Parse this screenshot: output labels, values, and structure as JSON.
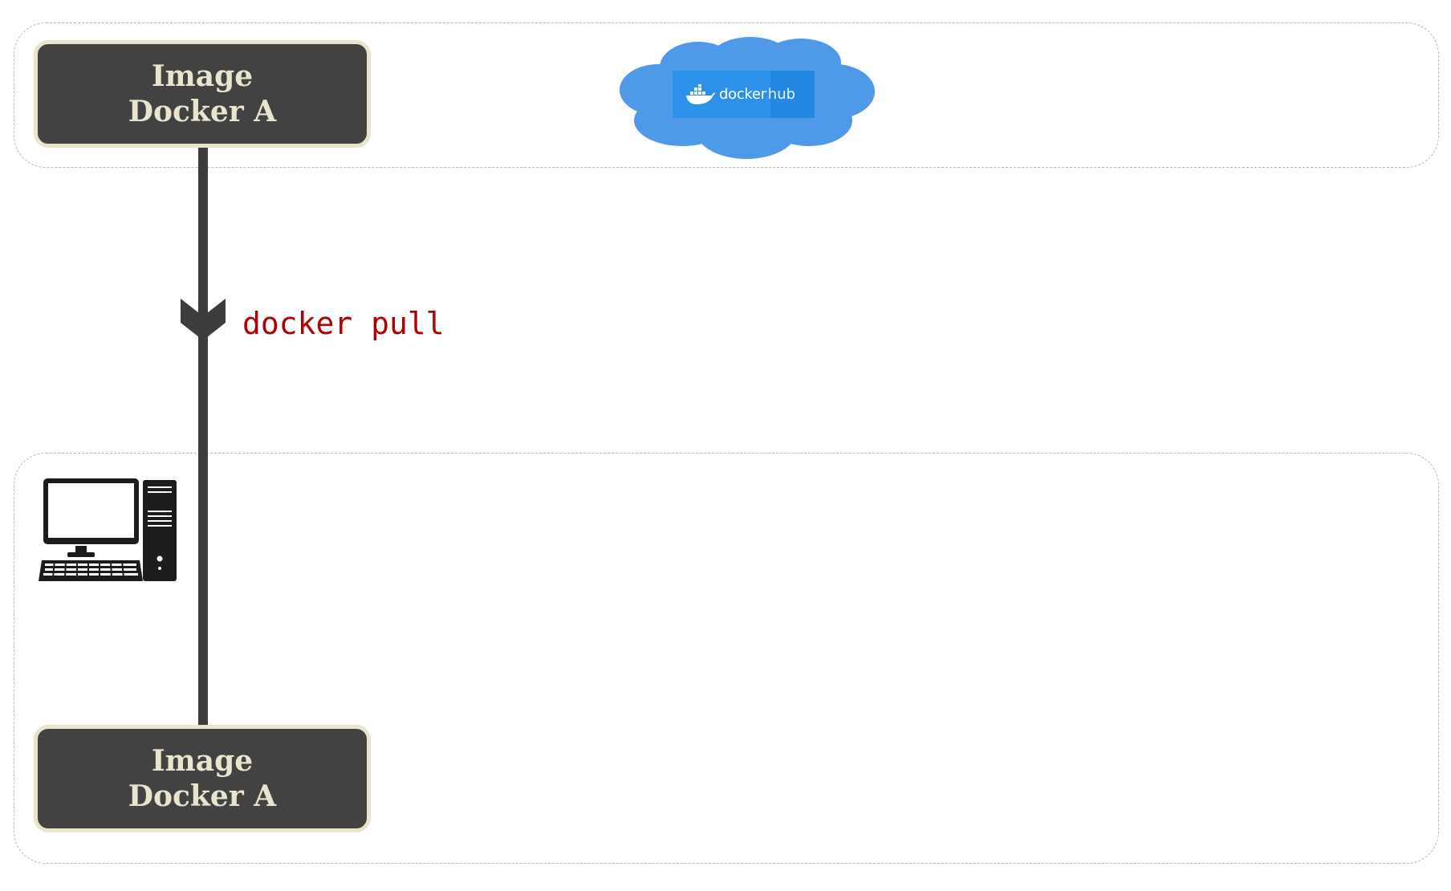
{
  "diagram": {
    "source_box": {
      "line1": "Image",
      "line2": "Docker A"
    },
    "target_box": {
      "line1": "Image",
      "line2": "Docker A"
    },
    "command": "docker pull",
    "registry": {
      "brand": "docker",
      "suffix": "hub"
    },
    "icons": {
      "registry": "docker-hub-cloud-icon",
      "host": "desktop-computer-icon",
      "arrow": "chevron-down-arrow-icon"
    }
  },
  "colors": {
    "box_fill": "#424242",
    "box_border": "#e8e4cd",
    "box_text": "#e8e4cd",
    "command_text": "#b00000",
    "cloud": "#4f99e9",
    "hub_logo": "#2c91e8",
    "connector": "#3d3d3d"
  }
}
